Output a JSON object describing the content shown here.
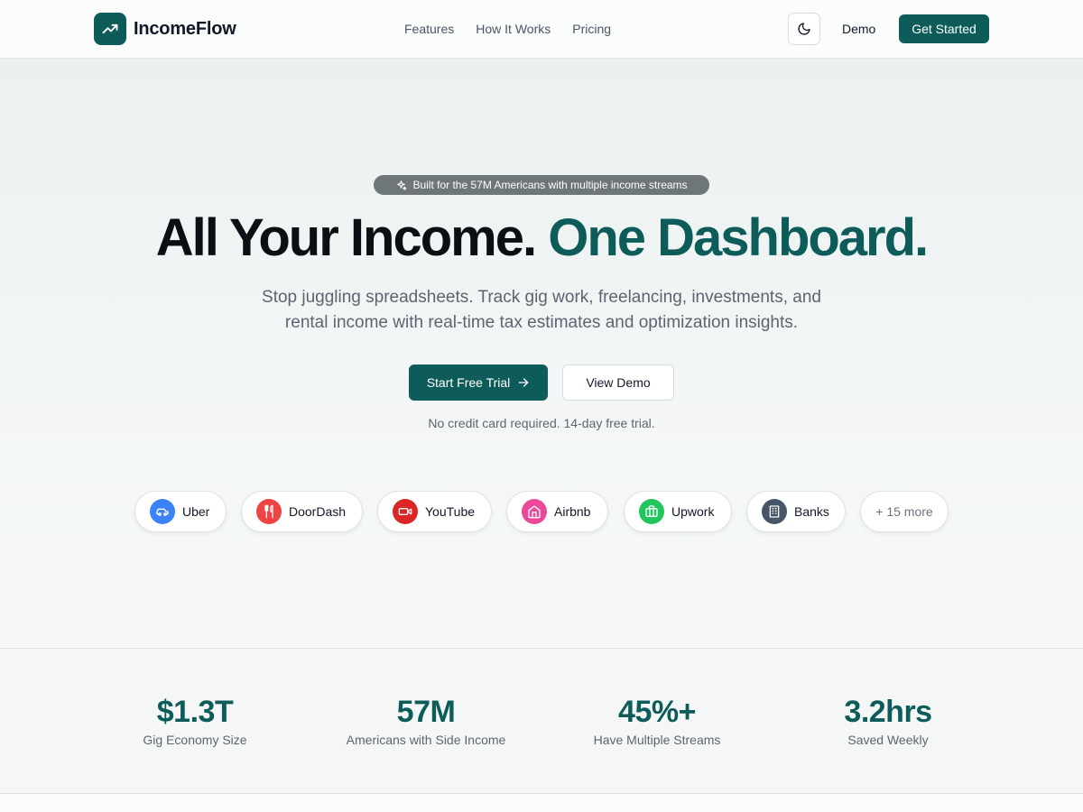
{
  "header": {
    "brand": "IncomeFlow",
    "nav": [
      "Features",
      "How It Works",
      "Pricing"
    ],
    "demo": "Demo",
    "get_started": "Get Started"
  },
  "hero": {
    "badge": "Built for the 57M Americans with multiple income streams",
    "headline_main": "All Your Income.",
    "headline_accent": "One Dashboard.",
    "subtext_line1": "Stop juggling spreadsheets. Track gig work, freelancing, investments, and",
    "subtext_line2": "rental income with real-time tax estimates and optimization insights.",
    "cta_primary": "Start Free Trial",
    "cta_secondary": "View Demo",
    "note": "No credit card required. 14-day free trial."
  },
  "platforms": [
    {
      "label": "Uber",
      "icon": "car-icon",
      "color": "#3b82f6"
    },
    {
      "label": "DoorDash",
      "icon": "utensils-icon",
      "color": "#ef4444"
    },
    {
      "label": "YouTube",
      "icon": "video-icon",
      "color": "#dc2626"
    },
    {
      "label": "Airbnb",
      "icon": "home-icon",
      "color": "#ec4899"
    },
    {
      "label": "Upwork",
      "icon": "briefcase-icon",
      "color": "#22c55e"
    },
    {
      "label": "Banks",
      "icon": "building-icon",
      "color": "#475569"
    }
  ],
  "more_platforms": "+ 15 more",
  "stats": [
    {
      "value": "$1.3T",
      "label": "Gig Economy Size"
    },
    {
      "value": "57M",
      "label": "Americans with Side Income"
    },
    {
      "value": "45%+",
      "label": "Have Multiple Streams"
    },
    {
      "value": "3.2hrs",
      "label": "Saved Weekly"
    }
  ],
  "colors": {
    "brand": "#0d5c5a",
    "badge_bg": "#6f7677"
  }
}
